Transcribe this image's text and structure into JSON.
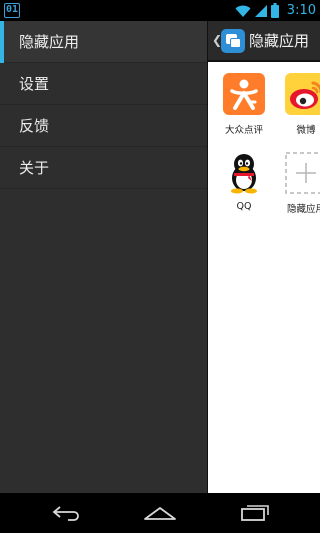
{
  "status_bar": {
    "notification_icon_text": "01",
    "time": "3:10",
    "icons": [
      "wifi-icon",
      "signal-icon",
      "battery-icon"
    ]
  },
  "drawer": {
    "items": [
      {
        "label": "隐藏应用",
        "active": true
      },
      {
        "label": "设置",
        "active": false
      },
      {
        "label": "反馈",
        "active": false
      },
      {
        "label": "关于",
        "active": false
      }
    ]
  },
  "action_bar": {
    "title": "隐藏应用"
  },
  "apps": [
    {
      "label": "大众点评",
      "icon": "dianping-icon"
    },
    {
      "label": "微博",
      "icon": "weibo-icon"
    },
    {
      "label": "QQ",
      "icon": "qq-icon"
    },
    {
      "label": "隐藏应用",
      "icon": "add-app-icon"
    }
  ],
  "nav_bar": {
    "buttons": [
      "back-icon",
      "home-icon",
      "recent-apps-icon"
    ]
  },
  "colors": {
    "accent": "#33b5e5",
    "drawer_bg": "#2e2e2e",
    "dianping_orange": "#ff7d2a",
    "weibo_yellow": "#ffd13a"
  }
}
